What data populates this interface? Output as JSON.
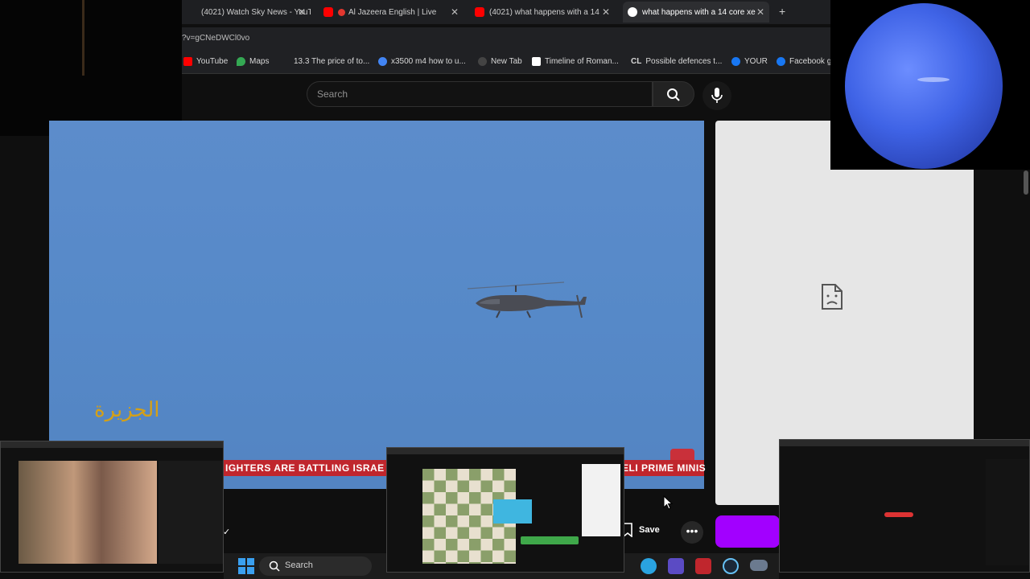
{
  "browser": {
    "tabs": [
      {
        "title": "(4021) Watch Sky News - YouTu",
        "active": false
      },
      {
        "title": "Al Jazeera English | Live",
        "active": false
      },
      {
        "title": "(4021) what happens with a 14",
        "active": false
      },
      {
        "title": "what happens with a 14 core xe",
        "active": true
      }
    ],
    "new_tab_label": "+",
    "url": "?v=gCNeDWCl0vo",
    "bookmarks": [
      {
        "label": "YouTube",
        "color": "#ff0000"
      },
      {
        "label": "Maps",
        "color": "#34a853"
      },
      {
        "label": "13.3 The price of to...",
        "color": "#1e1f22"
      },
      {
        "label": "x3500 m4 how to u...",
        "color": "#4285f4"
      },
      {
        "label": "New Tab",
        "color": "#444444"
      },
      {
        "label": "Timeline of Roman...",
        "color": "#ffffff"
      },
      {
        "label": "Possible defences t...",
        "color": "#202124"
      },
      {
        "label": "YOUR",
        "color": "#1877f2"
      },
      {
        "label": "Facebook gr",
        "color": "#1877f2"
      }
    ]
  },
  "youtube": {
    "search_placeholder": "Search",
    "video": {
      "ticker_text": "IGHTERS ARE BATTLING ISRAE",
      "ticker_text_right": "ELI PRIME MINIS",
      "channel_logo_text": "الجزيرة"
    },
    "actions": {
      "save_label": "Save",
      "more_label": "•••"
    }
  },
  "taskbar": {
    "search_label": "Search"
  },
  "colors": {
    "youtube_red": "#ff0000",
    "ticker_red": "#c0262d",
    "sky_blue": "#5689c8",
    "accent_purple": "#a200ff"
  }
}
